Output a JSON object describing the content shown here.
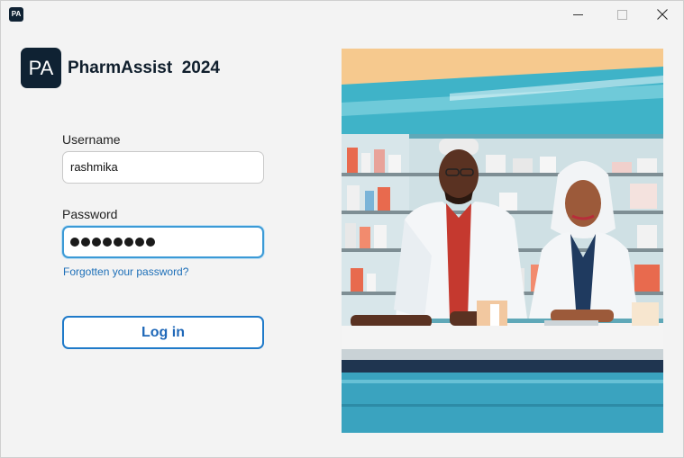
{
  "window": {
    "icon_text": "PA",
    "controls": {
      "minimize_icon": "minimize-icon",
      "maximize_icon": "maximize-icon",
      "close_icon": "close-icon"
    }
  },
  "header": {
    "logo_text": "PA",
    "title": "PharmAssist  2024"
  },
  "form": {
    "username_label": "Username",
    "username_value": "rashmika",
    "password_label": "Password",
    "password_mask": "●●●●●●●●",
    "password_length": 8,
    "forgot_link": "Forgotten your password?",
    "login_button": "Log in"
  },
  "hero": {
    "image": "pharmacists-illustration"
  },
  "colors": {
    "brand_dark": "#0f2233",
    "accent_blue": "#1f7ac9",
    "focus_border": "#3b9ad6",
    "link": "#1d6fb8"
  }
}
